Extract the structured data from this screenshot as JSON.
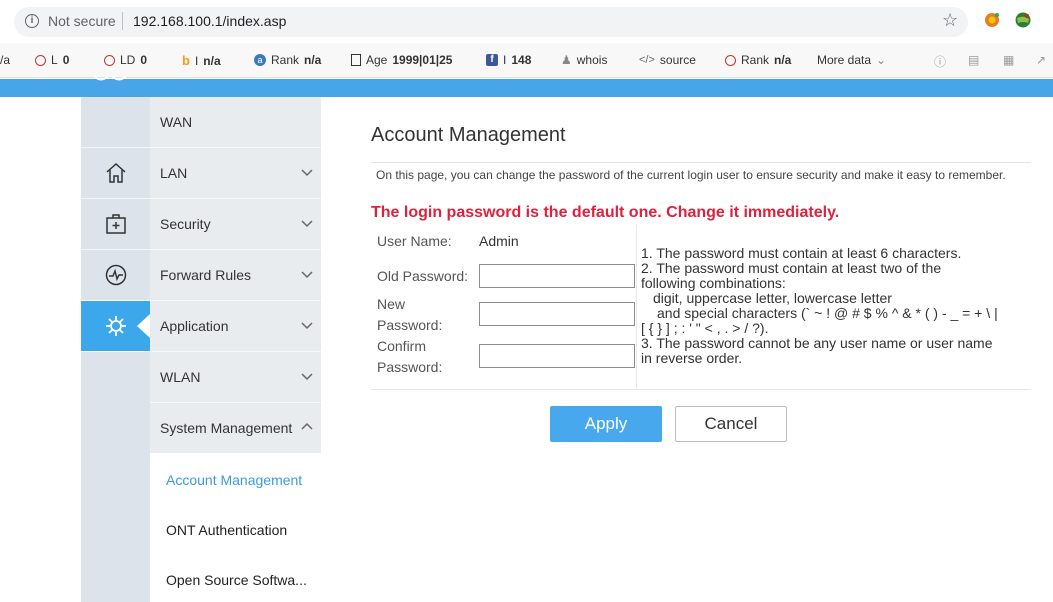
{
  "browser": {
    "security_label": "Not secure",
    "url": "192.168.100.1/index.asp",
    "info_icon": "info-icon",
    "bookmark_icon": "star-icon"
  },
  "seo_bar": {
    "item_a": "/a",
    "l_label": "L",
    "l_value": "0",
    "ld_label": "LD",
    "ld_value": "0",
    "i_label": "I",
    "i_value": "n/a",
    "rank1_label": "Rank",
    "rank1_value": "n/a",
    "age_label": "Age",
    "age_value": "1999|01|25",
    "fb_label": "I",
    "fb_value": "148",
    "whois": "whois",
    "source": "source",
    "rank2_label": "Rank",
    "rank2_value": "n/a",
    "more_data": "More data"
  },
  "nav": {
    "menu": [
      {
        "label": "WAN"
      },
      {
        "label": "LAN"
      },
      {
        "label": "Security"
      },
      {
        "label": "Forward Rules"
      },
      {
        "label": "Application"
      },
      {
        "label": "WLAN"
      },
      {
        "label": "System Management"
      }
    ],
    "submenu": [
      {
        "label": "Account Management"
      },
      {
        "label": "ONT Authentication"
      },
      {
        "label": "Open Source Softwa..."
      }
    ]
  },
  "page": {
    "title": "Account Management",
    "description": "On this page, you can change the password of the current login user to ensure security and make it easy to remember.",
    "warning": "The login password is the default one. Change it immediately.",
    "warning_color": "#e0213d",
    "accent_color": "#47a8ee"
  },
  "form": {
    "username_label": "User Name:",
    "username_value": "Admin",
    "old_password_label": "Old Password:",
    "new_password_label_1": "New",
    "new_password_label_2": "Password:",
    "confirm_password_label_1": "Confirm",
    "confirm_password_label_2": "Password:",
    "old_password_value": "",
    "new_password_value": "",
    "confirm_password_value": ""
  },
  "hints": {
    "line1": "1. The password must contain at least 6 characters.",
    "line2": "2. The password must contain at least two of the",
    "line3": "following combinations:",
    "line4": "digit, uppercase letter, lowercase letter",
    "line5": "and special characters (` ~ ! @ # $ % ^ & * ( ) - _ = + \\ |",
    "line6": "[ { } ] ; : ' \" < , . > / ?).",
    "line7": "3. The password cannot be any user name or user name",
    "line8": "in reverse order."
  },
  "buttons": {
    "apply": "Apply",
    "cancel": "Cancel"
  }
}
